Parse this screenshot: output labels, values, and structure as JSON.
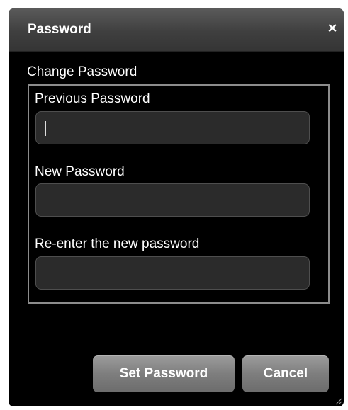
{
  "dialog": {
    "title": "Password",
    "close_glyph": "×"
  },
  "form": {
    "legend": "Change Password",
    "fields": [
      {
        "label": "Previous Password",
        "value": "",
        "focused": true
      },
      {
        "label": "New Password",
        "value": "",
        "focused": false
      },
      {
        "label": "Re-enter the new password",
        "value": "",
        "focused": false
      }
    ]
  },
  "buttons": {
    "set_password": "Set Password",
    "cancel": "Cancel"
  },
  "icons": {
    "close": "close-icon",
    "resize": "resize-grip-icon"
  },
  "colors": {
    "background": "#000000",
    "titlebar": "#4a4a4a",
    "button": "#8a8a8a",
    "input": "#2b2b2b"
  }
}
